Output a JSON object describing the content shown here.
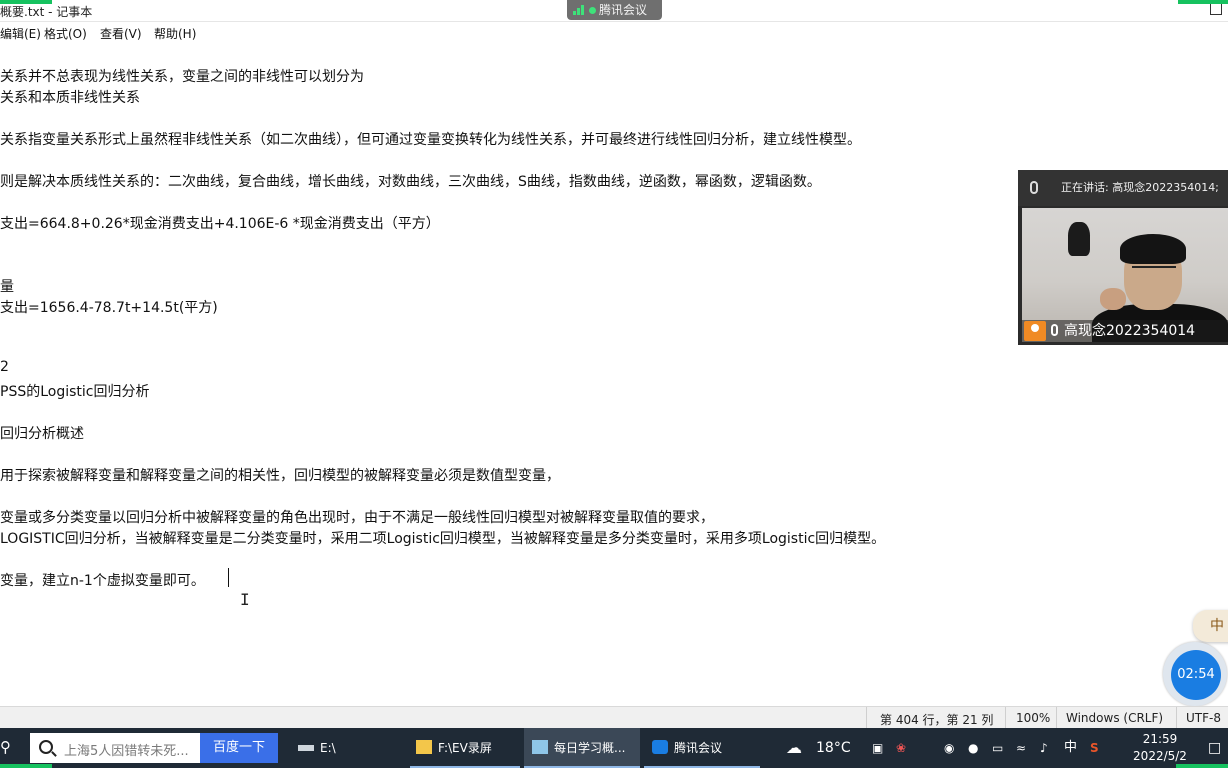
{
  "window": {
    "title": "概要.txt - 记事本"
  },
  "meeting_badge": {
    "label": "腾讯会议"
  },
  "menu": [
    "编辑(E)",
    "格式(O)",
    "查看(V)",
    "帮助(H)"
  ],
  "editor": {
    "lines": [
      "关系并不总表现为线性关系，变量之间的非线性可以划分为",
      "关系和本质非线性关系",
      "关系指变量关系形式上虽然程非线性关系（如二次曲线），但可通过变量变换转化为线性关系，并可最终进行线性回归分析，建立线性模型。",
      "则是解决本质线性关系的：二次曲线，复合曲线，增长曲线，对数曲线，三次曲线，S曲线，指数曲线，逆函数，幂函数，逻辑函数。",
      "支出=664.8+0.26*现金消费支出+4.106E-6 *现金消费支出（平方）",
      "量",
      "支出=1656.4-78.7t+14.5t(平方)",
      "2",
      "PSS的Logistic回归分析",
      "回归分析概述",
      "用于探索被解释变量和解释变量之间的相关性，回归模型的被解释变量必须是数值型变量，",
      "变量或多分类变量以回归分析中被解释变量的角色出现时，由于不满足一般线性回归模型对被解释变量取值的要求，",
      "LOGISTIC回归分析，当被解释变量是二分类变量时，采用二项Logistic回归模型，当被解释变量是多分类变量时，采用多项Logistic回归模型。",
      "变量，建立n-1个虚拟变量即可。"
    ]
  },
  "video": {
    "speaking": "正在讲话: 高现念2022354014;",
    "name": "高现念2022354014"
  },
  "ime": {
    "label": "中"
  },
  "timer": {
    "value": "02:54"
  },
  "status": {
    "position": "第 404 行，第 21 列",
    "zoom": "100%",
    "line_ending": "Windows (CRLF)",
    "encoding": "UTF-8"
  },
  "taskbar": {
    "search_placeholder": "上海5人因错转未死...",
    "search_button": "百度一下",
    "tasks": [
      "E:\\",
      "F:\\EV录屏",
      "每日学习概...",
      "腾讯会议"
    ],
    "weather": "18°C",
    "ime": "中",
    "time": "21:59",
    "date": "2022/5/2"
  },
  "colors": {
    "accent_green": "#16c25f",
    "taskbar": "#1f2a36",
    "search_button": "#3a6fe8",
    "timer": "#1a7de2"
  }
}
